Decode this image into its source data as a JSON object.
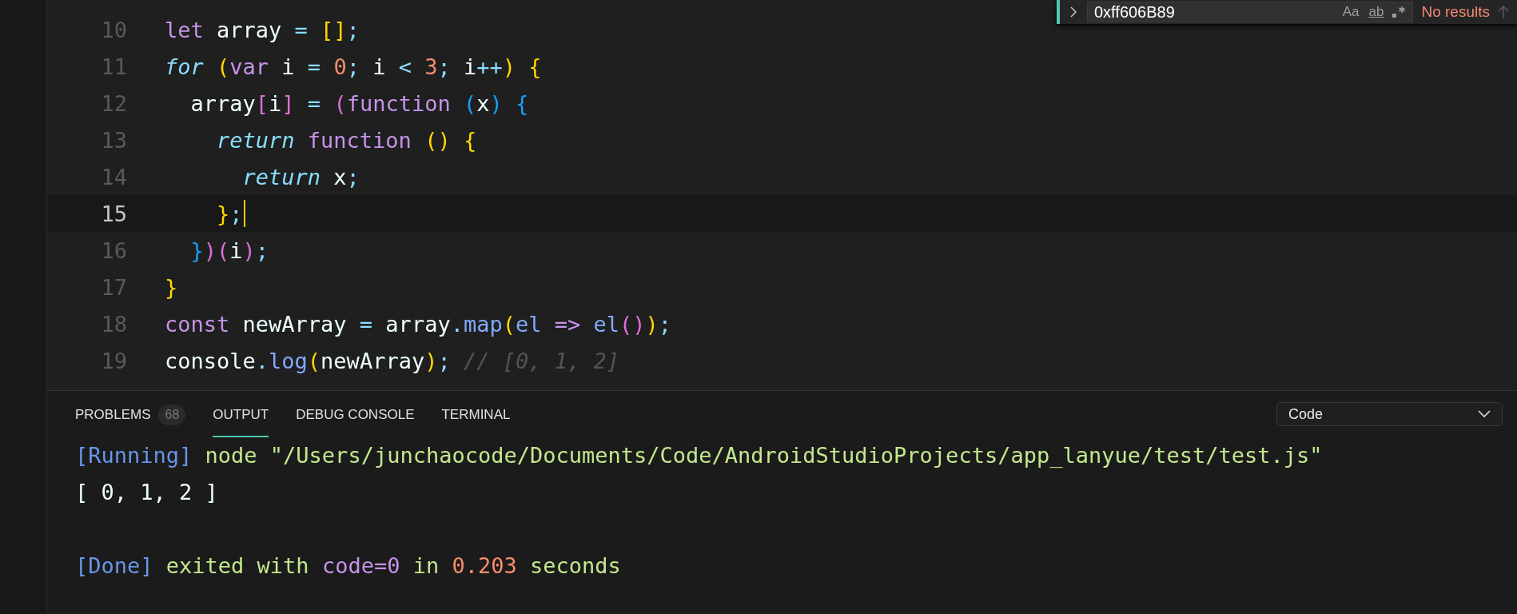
{
  "find_widget": {
    "value": "0xff606B89",
    "toggles": [
      {
        "label": "Aa",
        "selected": false
      },
      {
        "label": "ab",
        "selected": false
      }
    ],
    "result": "No results"
  },
  "editor": {
    "lines": [
      {
        "number": "10",
        "current": false,
        "tokens": [
          {
            "text": "let",
            "kind": "keyword"
          },
          {
            "text": " array ",
            "kind": "plain"
          },
          {
            "text": "= ",
            "kind": "operator"
          },
          {
            "text": "[]",
            "kind": "bracket1"
          },
          {
            "text": ";",
            "kind": "operator"
          }
        ]
      },
      {
        "number": "11",
        "current": false,
        "tokens": [
          {
            "text": "for ",
            "kind": "control"
          },
          {
            "text": "(",
            "kind": "bracket1"
          },
          {
            "text": "var",
            "kind": "keyword"
          },
          {
            "text": " i ",
            "kind": "plain"
          },
          {
            "text": "= ",
            "kind": "operator"
          },
          {
            "text": "0",
            "kind": "number"
          },
          {
            "text": ";",
            "kind": "operator"
          },
          {
            "text": " i ",
            "kind": "plain"
          },
          {
            "text": "< ",
            "kind": "operator"
          },
          {
            "text": "3",
            "kind": "number"
          },
          {
            "text": ";",
            "kind": "operator"
          },
          {
            "text": " i",
            "kind": "plain"
          },
          {
            "text": "++",
            "kind": "operator"
          },
          {
            "text": ")",
            "kind": "bracket1"
          },
          {
            "text": " {",
            "kind": "bracket1"
          }
        ]
      },
      {
        "number": "12",
        "current": false,
        "tokens": [
          {
            "text": "  array",
            "kind": "plain"
          },
          {
            "text": "[",
            "kind": "bracket2"
          },
          {
            "text": "i",
            "kind": "plain"
          },
          {
            "text": "]",
            "kind": "bracket2"
          },
          {
            "text": " = ",
            "kind": "operator"
          },
          {
            "text": "(",
            "kind": "bracket2"
          },
          {
            "text": "function ",
            "kind": "keyword"
          },
          {
            "text": "(",
            "kind": "bracket3"
          },
          {
            "text": "x",
            "kind": "plain"
          },
          {
            "text": ")",
            "kind": "bracket3"
          },
          {
            "text": " {",
            "kind": "bracket3"
          }
        ]
      },
      {
        "number": "13",
        "current": false,
        "tokens": [
          {
            "text": "    return ",
            "kind": "control"
          },
          {
            "text": "function ",
            "kind": "keyword"
          },
          {
            "text": "() {",
            "kind": "bracket1"
          }
        ]
      },
      {
        "number": "14",
        "current": false,
        "tokens": [
          {
            "text": "      return",
            "kind": "control"
          },
          {
            "text": " x",
            "kind": "plain"
          },
          {
            "text": ";",
            "kind": "operator"
          }
        ]
      },
      {
        "number": "15",
        "current": true,
        "tokens": [
          {
            "text": "    }",
            "kind": "bracket1"
          },
          {
            "text": ";",
            "kind": "operator"
          }
        ]
      },
      {
        "number": "16",
        "current": false,
        "tokens": [
          {
            "text": "  }",
            "kind": "bracket3"
          },
          {
            "text": ")(",
            "kind": "bracket2"
          },
          {
            "text": "i",
            "kind": "plain"
          },
          {
            "text": ")",
            "kind": "bracket2"
          },
          {
            "text": ";",
            "kind": "operator"
          }
        ]
      },
      {
        "number": "17",
        "current": false,
        "tokens": [
          {
            "text": "}",
            "kind": "bracket1"
          }
        ]
      },
      {
        "number": "18",
        "current": false,
        "tokens": [
          {
            "text": "const",
            "kind": "keyword"
          },
          {
            "text": " newArray ",
            "kind": "plain"
          },
          {
            "text": "=",
            "kind": "operator"
          },
          {
            "text": " array",
            "kind": "plain"
          },
          {
            "text": ".",
            "kind": "operator"
          },
          {
            "text": "map",
            "kind": "function"
          },
          {
            "text": "(",
            "kind": "bracket1"
          },
          {
            "text": "el ",
            "kind": "function"
          },
          {
            "text": "=> ",
            "kind": "keyword"
          },
          {
            "text": "el",
            "kind": "function"
          },
          {
            "text": "()",
            "kind": "bracket2"
          },
          {
            "text": ")",
            "kind": "bracket1"
          },
          {
            "text": ";",
            "kind": "operator"
          }
        ]
      },
      {
        "number": "19",
        "current": false,
        "tokens": [
          {
            "text": "console",
            "kind": "plain"
          },
          {
            "text": ".",
            "kind": "operator"
          },
          {
            "text": "log",
            "kind": "function"
          },
          {
            "text": "(",
            "kind": "bracket1"
          },
          {
            "text": "newArray",
            "kind": "plain"
          },
          {
            "text": ")",
            "kind": "bracket1"
          },
          {
            "text": "; ",
            "kind": "operator"
          },
          {
            "text": "// [0, 1, 2]",
            "kind": "comment"
          }
        ]
      }
    ]
  },
  "panel": {
    "tabs": [
      {
        "label": "PROBLEMS",
        "badge": "68",
        "selected": false
      },
      {
        "label": "OUTPUT",
        "selected": true
      },
      {
        "label": "DEBUG CONSOLE",
        "selected": false
      },
      {
        "label": "TERMINAL",
        "selected": false
      }
    ],
    "channel": "Code",
    "output": [
      {
        "tokens": [
          {
            "text": "[Running]",
            "kind": "tag"
          },
          {
            "text": " node \"/Users/junchaocode/Documents/Code/AndroidStudioProjects/app_lanyue/test/test.js\"",
            "kind": "string"
          }
        ]
      },
      {
        "tokens": [
          {
            "text": "[ 0, 1, 2 ]",
            "kind": "plain"
          }
        ]
      },
      {
        "tokens": [
          {
            "text": "[Done]",
            "kind": "tag"
          },
          {
            "text": " exited with ",
            "kind": "string"
          },
          {
            "text": "code=0",
            "kind": "keyword"
          },
          {
            "text": " in ",
            "kind": "string"
          },
          {
            "text": "0.203",
            "kind": "number"
          },
          {
            "text": " seconds",
            "kind": "string"
          }
        ]
      }
    ]
  }
}
